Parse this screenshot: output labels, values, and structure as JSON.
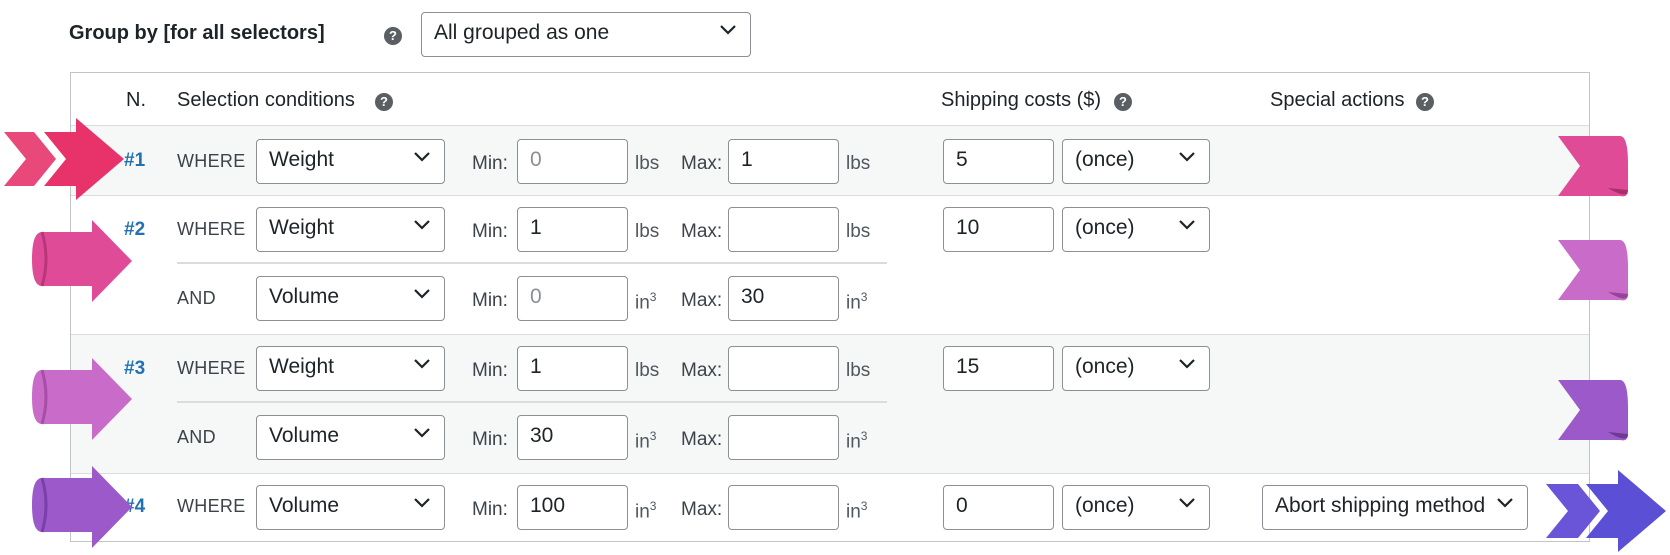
{
  "group_by": {
    "label": "Group by [for all selectors]",
    "value": "All grouped as one"
  },
  "table": {
    "headers": {
      "n": "N.",
      "conditions": "Selection conditions",
      "costs": "Shipping costs ($)",
      "special": "Special actions"
    },
    "labels": {
      "min": "Min:",
      "max": "Max:"
    },
    "rows": [
      {
        "num": "#1",
        "conditions": [
          {
            "keyword": "WHERE",
            "field": "Weight",
            "min": "",
            "min_placeholder": "0",
            "max": "1",
            "unit": "lbs"
          }
        ],
        "cost": "5",
        "cost_type": "(once)",
        "special": ""
      },
      {
        "num": "#2",
        "conditions": [
          {
            "keyword": "WHERE",
            "field": "Weight",
            "min": "1",
            "min_placeholder": "",
            "max": "",
            "unit": "lbs"
          },
          {
            "keyword": "AND",
            "field": "Volume",
            "min": "",
            "min_placeholder": "0",
            "max": "30",
            "unit": "in",
            "unit_sup": "3"
          }
        ],
        "cost": "10",
        "cost_type": "(once)",
        "special": ""
      },
      {
        "num": "#3",
        "conditions": [
          {
            "keyword": "WHERE",
            "field": "Weight",
            "min": "1",
            "min_placeholder": "",
            "max": "",
            "unit": "lbs"
          },
          {
            "keyword": "AND",
            "field": "Volume",
            "min": "30",
            "min_placeholder": "",
            "max": "",
            "unit": "in",
            "unit_sup": "3"
          }
        ],
        "cost": "15",
        "cost_type": "(once)",
        "special": ""
      },
      {
        "num": "#4",
        "conditions": [
          {
            "keyword": "WHERE",
            "field": "Volume",
            "min": "100",
            "min_placeholder": "",
            "max": "",
            "unit": "in",
            "unit_sup": "3"
          }
        ],
        "cost": "0",
        "cost_type": "(once)",
        "special": "Abort shipping method"
      }
    ]
  },
  "colors": {
    "arrow_1": "#e83e6f",
    "arrow_2": "#e04b98",
    "arrow_3": "#c96bc9",
    "arrow_4": "#9b59c9",
    "arrow_5": "#5b4fd6",
    "link": "#2271b1"
  },
  "icons": [
    "help-icon",
    "chevron-down-icon",
    "arrow-ribbon-icon"
  ]
}
